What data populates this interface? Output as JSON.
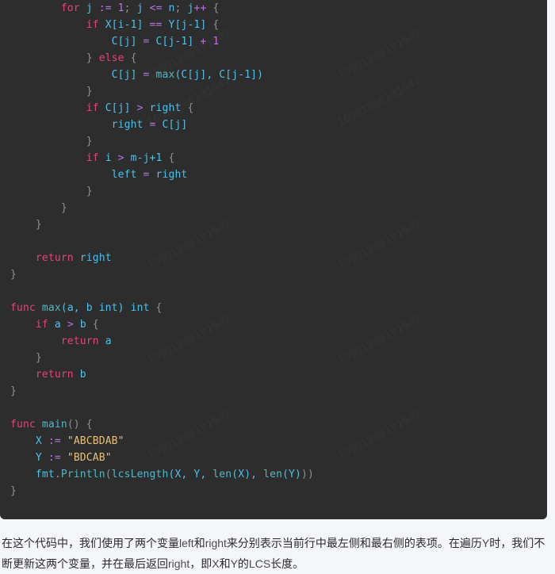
{
  "theme": {
    "page_background": "#f4f6fa",
    "code_background": "#2d2d2d",
    "keyword_color": "#e0457b",
    "identifier_color": "#4fc1e9",
    "function_color": "#56b6c2",
    "number_color": "#b974e0",
    "operator_color": "#b974e0",
    "string_color": "#e5c07b",
    "punctuation_color": "#8d9099",
    "paragraph_color": "#2b2b2b"
  },
  "code_block": {
    "language": "go",
    "watermark_text": "10901266191647",
    "lines": [
      "        for j := 1; j <= n; j++ {",
      "            if X[i-1] == Y[j-1] {",
      "                C[j] = C[j-1] + 1",
      "            } else {",
      "                C[j] = max(C[j], C[j-1])",
      "            }",
      "            if C[j] > right {",
      "                right = C[j]",
      "            }",
      "            if i > m-j+1 {",
      "                left = right",
      "            }",
      "        }",
      "    }",
      "",
      "    return right",
      "}",
      "",
      "func max(a, b int) int {",
      "    if a > b {",
      "        return a",
      "    }",
      "    return b",
      "}",
      "",
      "func main() {",
      "    X := \"ABCBDAB\"",
      "    Y := \"BDCAB\"",
      "    fmt.Println(lcsLength(X, Y, len(X), len(Y)))",
      "}"
    ],
    "tokens": {
      "l1": {
        "kw_for": "for",
        "id_j": "j",
        "op_assign": ":=",
        "num_1": "1",
        "semi1": ";",
        "id_j2": "j",
        "op_le": "<=",
        "id_n": "n",
        "semi2": ";",
        "id_j3": "j",
        "op_inc": "++",
        "brace": "{"
      },
      "l2": {
        "kw_if": "if",
        "id_x": "X",
        "idx1": "[i-1]",
        "op_eq": "==",
        "id_y": "Y",
        "idx2": "[j-1]",
        "brace": "{"
      },
      "l3": {
        "id_c": "C",
        "idx": "[j]",
        "op_eq": "=",
        "id_c2": "C",
        "idx2": "[j-1]",
        "op_plus": "+",
        "num_1": "1"
      },
      "l4": {
        "close": "}",
        "kw_else": "else",
        "brace": "{"
      },
      "l5": {
        "id_c": "C",
        "idx": "[j]",
        "op_eq": "=",
        "fn_max": "max",
        "args": "(C[j], C[j-1])"
      },
      "l6": {
        "close": "}"
      },
      "l7": {
        "kw_if": "if",
        "id_c": "C",
        "idx": "[j]",
        "op_gt": ">",
        "id_right": "right",
        "brace": "{"
      },
      "l8": {
        "id_right": "right",
        "op_eq": "=",
        "id_c": "C",
        "idx": "[j]"
      },
      "l9": {
        "close": "}"
      },
      "l10": {
        "kw_if": "if",
        "id_i": "i",
        "op_gt": ">",
        "expr": "m-j+1",
        "brace": "{"
      },
      "l11": {
        "id_left": "left",
        "op_eq": "=",
        "id_right": "right"
      },
      "l12": {
        "close": "}"
      },
      "l13": {
        "close": "}"
      },
      "l14": {
        "close": "}"
      },
      "l16": {
        "kw_return": "return",
        "id_right": "right"
      },
      "l17": {
        "close": "}"
      },
      "l19": {
        "kw_func": "func",
        "fn_name": "max",
        "params": "(a, b int)",
        "ret_type": "int",
        "brace": "{"
      },
      "l20": {
        "kw_if": "if",
        "id_a": "a",
        "op_gt": ">",
        "id_b": "b",
        "brace": "{"
      },
      "l21": {
        "kw_return": "return",
        "id_a": "a"
      },
      "l22": {
        "close": "}"
      },
      "l23": {
        "kw_return": "return",
        "id_b": "b"
      },
      "l24": {
        "close": "}"
      },
      "l26": {
        "kw_func": "func",
        "fn_name": "main",
        "params": "()",
        "brace": "{"
      },
      "l27": {
        "id_x": "X",
        "op_assign": ":=",
        "str": "\"ABCBDAB\""
      },
      "l28": {
        "id_y": "Y",
        "op_assign": ":=",
        "str": "\"BDCAB\""
      },
      "l29": {
        "pkg": "fmt",
        "dot": ".",
        "fn_println": "Println",
        "open": "(",
        "fn_lcs": "lcsLength",
        "args": "(X, Y, ",
        "fn_len1": "len",
        "arg_x": "(X), ",
        "fn_len2": "len",
        "arg_y": "(Y)",
        "close": "))"
      },
      "l30": {
        "close": "}"
      }
    }
  },
  "paragraph": {
    "line1_a": "在这个代码中，我们使用了两个变量",
    "line1_b": "left",
    "line1_c": "和",
    "line1_d": "right",
    "line1_e": "来分别表示当前行中最左侧和最右侧的表项。在遍历",
    "line1_f": "Y",
    "line1_g": "时，我们",
    "line2_a": "不断更新这两个变量，并在最后返回",
    "line2_b": "right",
    "line2_c": "，即",
    "line2_d": "X",
    "line2_e": "和",
    "line2_f": "Y",
    "line2_g": "的",
    "line2_h": "LCS",
    "line2_i": "长度。"
  }
}
